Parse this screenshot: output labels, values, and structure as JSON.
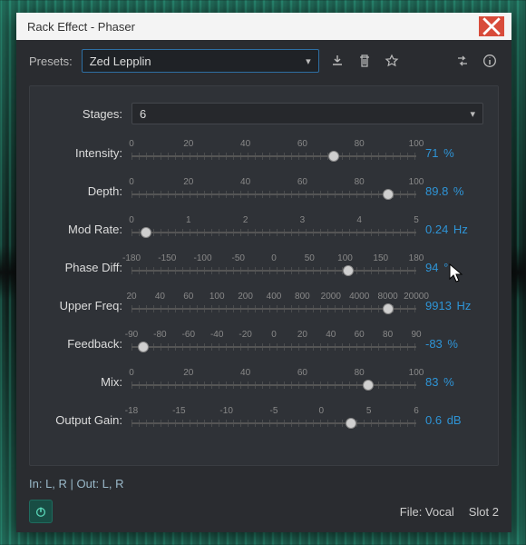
{
  "window_title": "Rack Effect - Phaser",
  "presets": {
    "label": "Presets:",
    "value": "Zed Lepplin"
  },
  "stages": {
    "label": "Stages:",
    "value": "6"
  },
  "sliders": [
    {
      "label": "Intensity:",
      "ticks": [
        "0",
        "20",
        "40",
        "60",
        "80",
        "100"
      ],
      "value": "71",
      "unit": "%",
      "pos": 0.71
    },
    {
      "label": "Depth:",
      "ticks": [
        "0",
        "20",
        "40",
        "60",
        "80",
        "100"
      ],
      "value": "89.8",
      "unit": "%",
      "pos": 0.9
    },
    {
      "label": "Mod Rate:",
      "ticks": [
        "0",
        "1",
        "2",
        "3",
        "4",
        "5"
      ],
      "value": "0.24",
      "unit": "Hz",
      "pos": 0.05
    },
    {
      "label": "Phase Diff:",
      "ticks": [
        "-180",
        "-150",
        "-100",
        "-50",
        "0",
        "50",
        "100",
        "150",
        "180"
      ],
      "value": "94",
      "unit": "°",
      "pos": 0.76
    },
    {
      "label": "Upper Freq:",
      "ticks": [
        "20",
        "40",
        "60",
        "100",
        "200",
        "400",
        "800",
        "2000",
        "4000",
        "8000",
        "20000"
      ],
      "value": "9913",
      "unit": "Hz",
      "pos": 0.9
    },
    {
      "label": "Feedback:",
      "ticks": [
        "-90",
        "-80",
        "-60",
        "-40",
        "-20",
        "0",
        "20",
        "40",
        "60",
        "80",
        "90"
      ],
      "value": "-83",
      "unit": "%",
      "pos": 0.04
    },
    {
      "label": "Mix:",
      "ticks": [
        "0",
        "20",
        "40",
        "60",
        "80",
        "100"
      ],
      "value": "83",
      "unit": "%",
      "pos": 0.83
    },
    {
      "label": "Output Gain:",
      "ticks": [
        "-18",
        "-15",
        "-10",
        "-5",
        "0",
        "5",
        "6"
      ],
      "value": "0.6",
      "unit": "dB",
      "pos": 0.77
    }
  ],
  "io_text": "In: L, R | Out: L, R",
  "file_label": "File: Vocal",
  "slot_label": "Slot 2",
  "icons": {
    "close": "close-icon",
    "download": "download-preset-icon",
    "trash": "delete-preset-icon",
    "star": "favorite-icon",
    "swap": "channel-map-icon",
    "info": "info-icon",
    "power": "power-icon",
    "chevron": "chevron-down-icon"
  }
}
